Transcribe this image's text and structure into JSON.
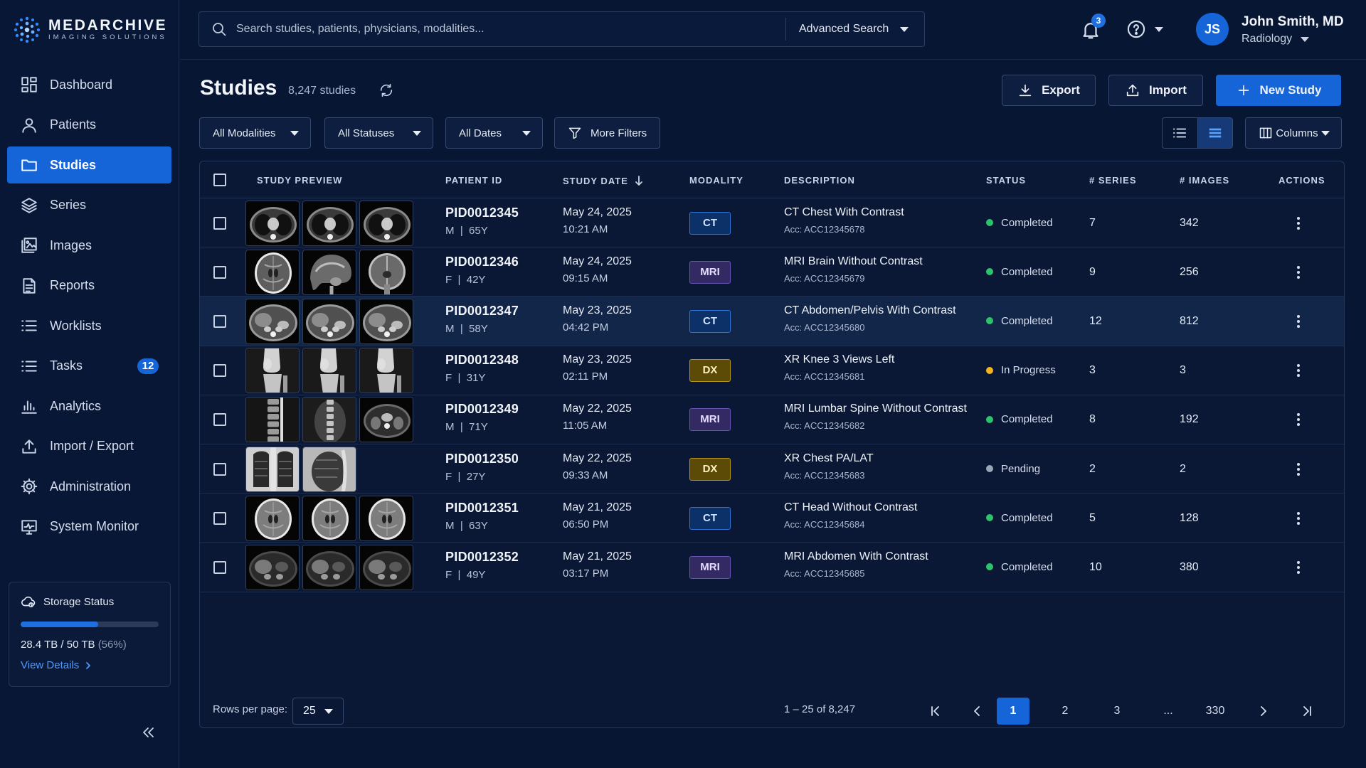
{
  "app": {
    "name": "MEDARCHIVE",
    "tagline": "IMAGING SOLUTIONS"
  },
  "colors": {
    "background": "#071633",
    "accent": "#1565d8",
    "status_completed": "#2cc36b",
    "status_in_progress": "#f2b51d",
    "status_pending": "#9aa6b8"
  },
  "sidebar": {
    "items": [
      {
        "label": "Dashboard",
        "icon": "dashboard-icon"
      },
      {
        "label": "Patients",
        "icon": "user-icon"
      },
      {
        "label": "Studies",
        "icon": "folder-icon",
        "active": true
      },
      {
        "label": "Series",
        "icon": "layers-icon"
      },
      {
        "label": "Images",
        "icon": "images-icon"
      },
      {
        "label": "Reports",
        "icon": "report-icon"
      },
      {
        "label": "Worklists",
        "icon": "list-icon"
      },
      {
        "label": "Tasks",
        "icon": "tasks-icon",
        "badge": "12"
      },
      {
        "label": "Analytics",
        "icon": "bar-chart-icon"
      },
      {
        "label": "Import / Export",
        "icon": "upload-icon"
      },
      {
        "label": "Administration",
        "icon": "gear-icon"
      },
      {
        "label": "System Monitor",
        "icon": "monitor-icon"
      }
    ],
    "storage": {
      "title": "Storage Status",
      "used_fraction": 0.56,
      "usage": "28.4 TB / 50 TB",
      "percent": "(56%)",
      "link": "View Details"
    }
  },
  "topbar": {
    "search_placeholder": "Search studies, patients, physicians, modalities...",
    "advanced": "Advanced Search",
    "notifications": "3",
    "user": {
      "initials": "JS",
      "name": "John Smith, MD",
      "role": "Radiology"
    }
  },
  "page": {
    "title": "Studies",
    "count": "8,247 studies",
    "buttons": {
      "export": "Export",
      "import": "Import",
      "new": "New Study"
    },
    "filters": [
      "All Modalities",
      "All Statuses",
      "All Dates",
      "More Filters"
    ],
    "columns_button": "Columns"
  },
  "table": {
    "headers": {
      "preview": "STUDY PREVIEW",
      "patient": "PATIENT ID",
      "date": "STUDY DATE",
      "modality": "MODALITY",
      "description": "DESCRIPTION",
      "status": "STATUS",
      "series": "# SERIES",
      "images": "# IMAGES",
      "actions": "ACTIONS"
    },
    "rows": [
      {
        "pid": "PID0012345",
        "demo": "M  |  65Y",
        "date": "May 24, 2025",
        "time": "10:21 AM",
        "modality": "CT",
        "desc": "CT Chest With Contrast",
        "acc": "Acc: ACC12345678",
        "status": "Completed",
        "series": "7",
        "images": "342",
        "thumbs": [
          "chest-ct",
          "chest-ct",
          "chest-ct"
        ]
      },
      {
        "pid": "PID0012346",
        "demo": "F  |  42Y",
        "date": "May 24, 2025",
        "time": "09:15 AM",
        "modality": "MRI",
        "desc": "MRI Brain Without Contrast",
        "acc": "Acc: ACC12345679",
        "status": "Completed",
        "series": "9",
        "images": "256",
        "thumbs": [
          "brain-axial",
          "brain-sagittal",
          "brain-coronal"
        ]
      },
      {
        "pid": "PID0012347",
        "demo": "M  |  58Y",
        "date": "May 23, 2025",
        "time": "04:42 PM",
        "modality": "CT",
        "desc": "CT Abdomen/Pelvis With Contrast",
        "acc": "Acc: ACC12345680",
        "status": "Completed",
        "series": "12",
        "images": "812",
        "thumbs": [
          "abdomen-ct",
          "abdomen-ct",
          "abdomen-ct"
        ],
        "highlighted": true
      },
      {
        "pid": "PID0012348",
        "demo": "F  |  31Y",
        "date": "May 23, 2025",
        "time": "02:11 PM",
        "modality": "DX",
        "desc": "XR Knee 3 Views Left",
        "acc": "Acc: ACC12345681",
        "status": "In Progress",
        "series": "3",
        "images": "3",
        "thumbs": [
          "knee-xr",
          "knee-xr",
          "knee-xr"
        ]
      },
      {
        "pid": "PID0012349",
        "demo": "M  |  71Y",
        "date": "May 22, 2025",
        "time": "11:05 AM",
        "modality": "MRI",
        "desc": "MRI Lumbar Spine Without Contrast",
        "acc": "Acc: ACC12345682",
        "status": "Completed",
        "series": "8",
        "images": "192",
        "thumbs": [
          "spine-sagittal",
          "spine-coronal",
          "spine-axial"
        ]
      },
      {
        "pid": "PID0012350",
        "demo": "F  |  27Y",
        "date": "May 22, 2025",
        "time": "09:33 AM",
        "modality": "DX",
        "desc": "XR Chest PA/LAT",
        "acc": "Acc: ACC12345683",
        "status": "Pending",
        "series": "2",
        "images": "2",
        "thumbs": [
          "chest-xr",
          "chest-lat-xr"
        ]
      },
      {
        "pid": "PID0012351",
        "demo": "M  |  63Y",
        "date": "May 21, 2025",
        "time": "06:50 PM",
        "modality": "CT",
        "desc": "CT Head Without Contrast",
        "acc": "Acc: ACC12345684",
        "status": "Completed",
        "series": "5",
        "images": "128",
        "thumbs": [
          "head-ct",
          "head-ct",
          "head-ct"
        ]
      },
      {
        "pid": "PID0012352",
        "demo": "F  |  49Y",
        "date": "May 21, 2025",
        "time": "03:17 PM",
        "modality": "MRI",
        "desc": "MRI Abdomen With Contrast",
        "acc": "Acc: ACC12345685",
        "status": "Completed",
        "series": "10",
        "images": "380",
        "thumbs": [
          "abdomen-mri",
          "abdomen-mri",
          "abdomen-mri"
        ]
      }
    ]
  },
  "footer": {
    "rows_label": "Rows per page:",
    "rows_value": "25",
    "range": "1 – 25 of 8,247",
    "pages": [
      "1",
      "2",
      "3",
      "...",
      "330"
    ],
    "current_page": "1"
  }
}
